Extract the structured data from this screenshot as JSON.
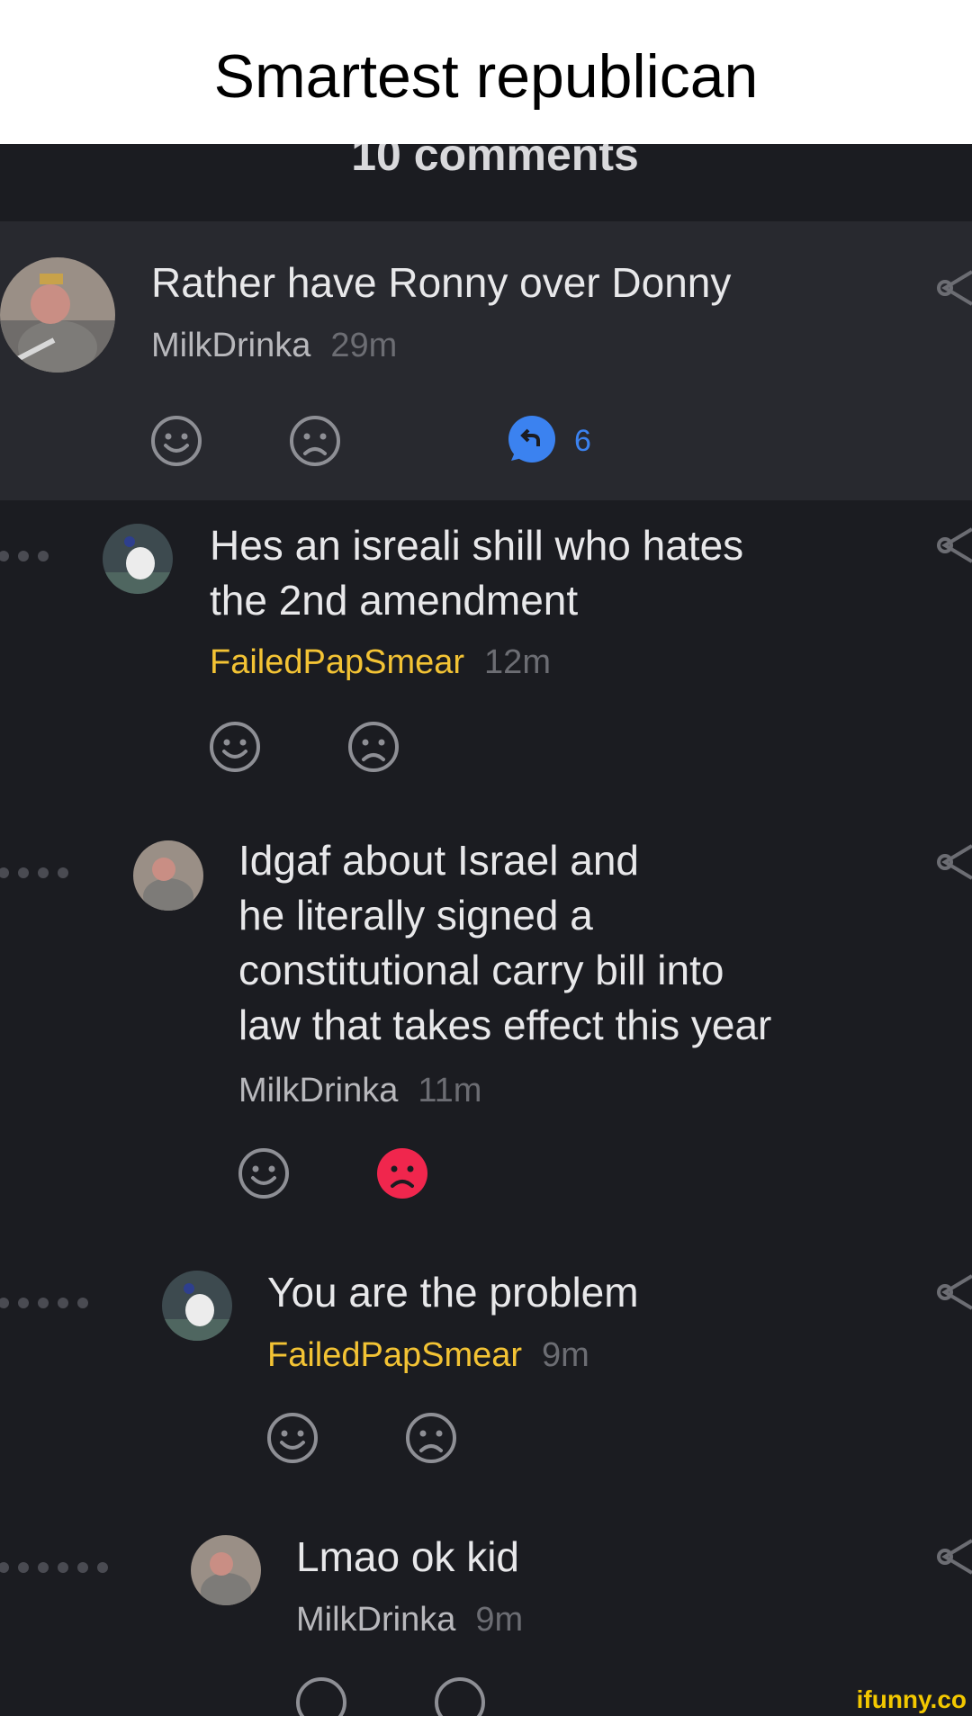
{
  "caption": "Smartest republican",
  "header": {
    "comments_title": "10 comments"
  },
  "comments": [
    {
      "text": "Rather have Ronny over Donny",
      "author": "MilkDrinka",
      "time": "29m",
      "replies": "6"
    },
    {
      "text_lines": [
        "Hes an isreali shill who hates",
        "the 2nd amendment"
      ],
      "author": "FailedPapSmear",
      "time": "12m"
    },
    {
      "text_lines": [
        "Idgaf about Israel and",
        "he literally signed a",
        "constitutional carry bill into",
        "law that takes effect this year"
      ],
      "author": "MilkDrinka",
      "time": "11m"
    },
    {
      "text": "You are the problem",
      "author": "FailedPapSmear",
      "time": "9m"
    },
    {
      "text": "Lmao ok kid",
      "author": "MilkDrinka",
      "time": "9m"
    }
  ],
  "icons": {
    "like": "smile-icon",
    "dislike": "frown-icon",
    "reply": "reply-bubble-icon",
    "share": "share-icon"
  },
  "colors": {
    "accent_blue": "#3b82f0",
    "dislike_active": "#f0264d",
    "username_gold": "#f3c334"
  },
  "watermark": "ifunny.co"
}
